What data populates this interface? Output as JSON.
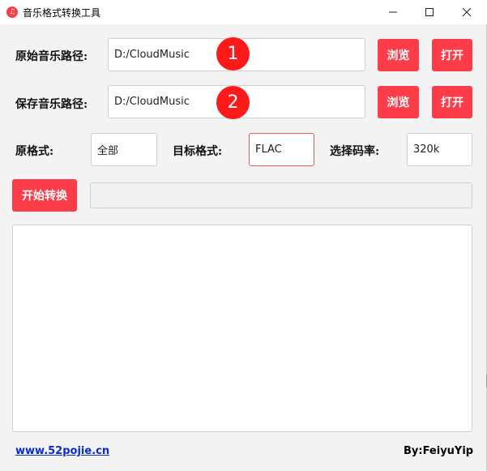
{
  "window": {
    "title": "音乐格式转换工具",
    "icon": "music-note-icon",
    "accent": "#fc3d49"
  },
  "source": {
    "label": "原始音乐路径:",
    "value": "D:/CloudMusic",
    "marker": "1",
    "browse_label": "浏览",
    "open_label": "打开"
  },
  "save": {
    "label": "保存音乐路径:",
    "value": "D:/CloudMusic",
    "marker": "2",
    "browse_label": "浏览",
    "open_label": "打开"
  },
  "format": {
    "source_label": "原格式:",
    "source_value": "全部",
    "target_label": "目标格式:",
    "target_value": "FLAC",
    "bitrate_label": "选择码率:",
    "bitrate_value": "320k"
  },
  "actions": {
    "start_label": "开始转换",
    "progress": 0
  },
  "footer": {
    "link_text": "www.52pojie.cn",
    "credit": "By:FeiyuYip"
  }
}
